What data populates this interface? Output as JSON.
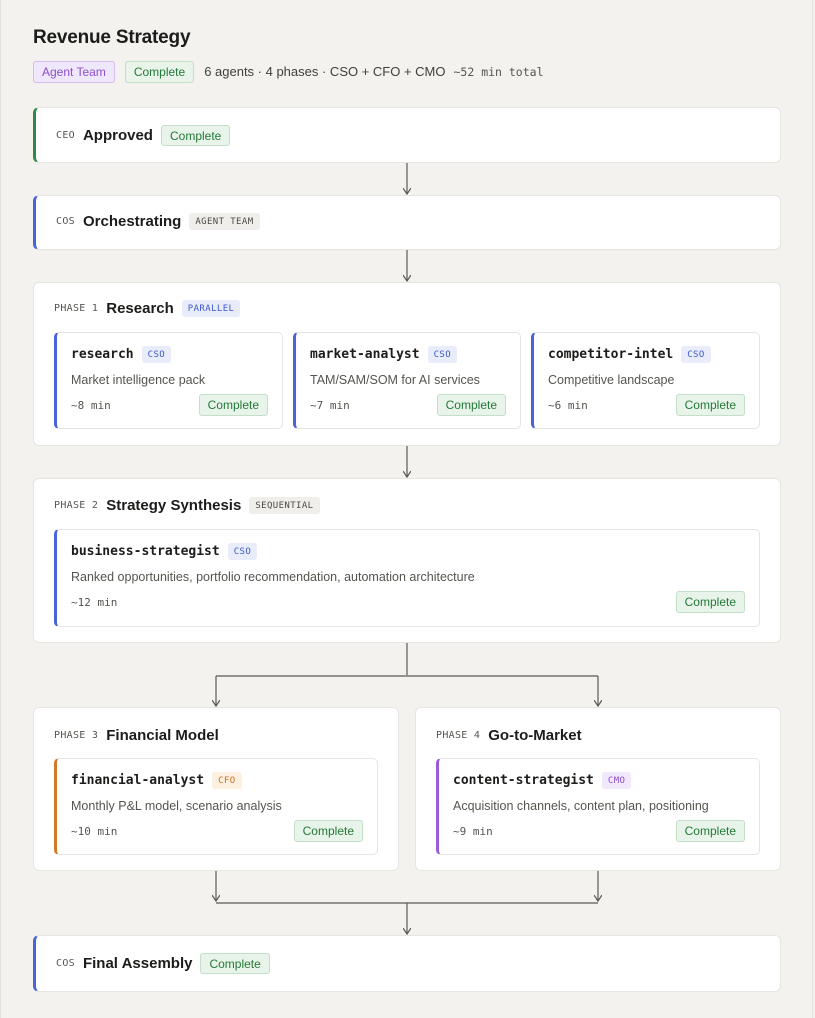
{
  "header": {
    "title": "Revenue Strategy",
    "team_badge": "Agent Team",
    "status_badge": "Complete",
    "summary": "6 agents · 4 phases · CSO + CFO + CMO",
    "duration": "~52 min total"
  },
  "ceo": {
    "role": "CEO",
    "title": "Approved",
    "status": "Complete"
  },
  "cos": {
    "role": "COS",
    "title": "Orchestrating",
    "tag": "AGENT TEAM"
  },
  "phase1": {
    "label": "PHASE 1",
    "title": "Research",
    "mode": "PARALLEL",
    "agents": [
      {
        "name": "research",
        "role": "CSO",
        "desc": "Market intelligence pack",
        "duration": "~8 min",
        "status": "Complete"
      },
      {
        "name": "market-analyst",
        "role": "CSO",
        "desc": "TAM/SAM/SOM for AI services",
        "duration": "~7 min",
        "status": "Complete"
      },
      {
        "name": "competitor-intel",
        "role": "CSO",
        "desc": "Competitive landscape",
        "duration": "~6 min",
        "status": "Complete"
      }
    ]
  },
  "phase2": {
    "label": "PHASE 2",
    "title": "Strategy Synthesis",
    "mode": "SEQUENTIAL",
    "agents": [
      {
        "name": "business-strategist",
        "role": "CSO",
        "desc": "Ranked opportunities, portfolio recommendation, automation architecture",
        "duration": "~12 min",
        "status": "Complete"
      }
    ]
  },
  "phase3": {
    "label": "PHASE 3",
    "title": "Financial Model",
    "agents": [
      {
        "name": "financial-analyst",
        "role": "CFO",
        "desc": "Monthly P&L model, scenario analysis",
        "duration": "~10 min",
        "status": "Complete"
      }
    ]
  },
  "phase4": {
    "label": "PHASE 4",
    "title": "Go-to-Market",
    "agents": [
      {
        "name": "content-strategist",
        "role": "CMO",
        "desc": "Acquisition channels, content plan, positioning",
        "duration": "~9 min",
        "status": "Complete"
      }
    ]
  },
  "final": {
    "role": "COS",
    "title": "Final Assembly",
    "status": "Complete"
  },
  "colors": {
    "ceo_accent": "#2f8a45",
    "cos_accent": "#4a63d8",
    "cso_accent": "#4a63d8",
    "cfo_accent": "#d47a26",
    "cmo_accent": "#9b5ad6",
    "connector": "#5a5a56"
  }
}
